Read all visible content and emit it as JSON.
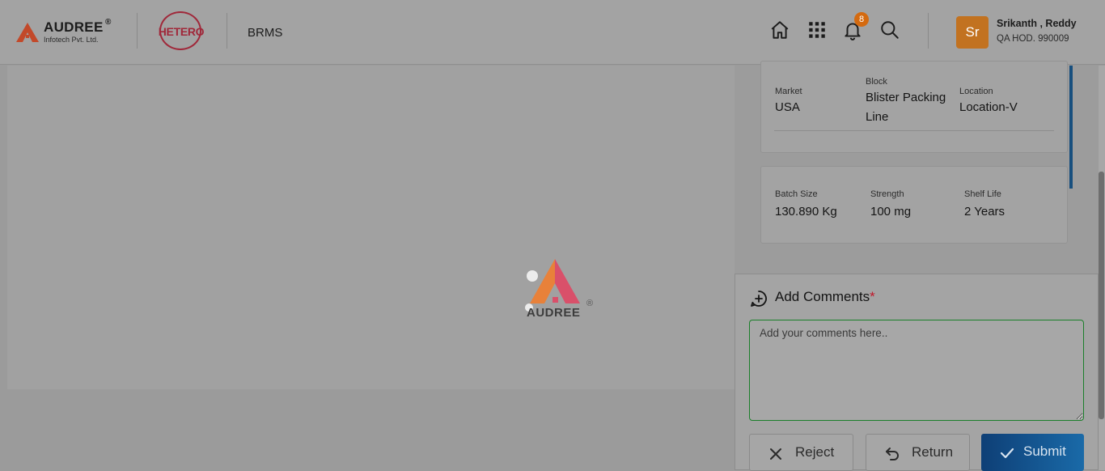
{
  "header": {
    "brand": {
      "name": "AUDREE",
      "registered": "®",
      "subtitle": "Infotech Pvt. Ltd."
    },
    "partner_logo": "HETERO",
    "app_name": "BRMS",
    "icons": [
      "home-icon",
      "apps-grid-icon",
      "bell-icon",
      "search-icon"
    ],
    "notification_count": "8",
    "user": {
      "initials": "Sr",
      "name": "Srikanth , Reddy",
      "role": "QA HOD. 990009"
    }
  },
  "loader": {
    "text": "AUDREE",
    "registered": "®"
  },
  "details": {
    "card1": {
      "market_label": "Market",
      "market_value": "USA",
      "block_label": "Block",
      "block_value": "Blister Packing Line",
      "location_label": "Location",
      "location_value": "Location-V"
    },
    "card2": {
      "batch_size_label": "Batch Size",
      "batch_size_value": "130.890 Kg",
      "strength_label": "Strength",
      "strength_value": "100 mg",
      "shelf_life_label": "Shelf Life",
      "shelf_life_value": "2 Years"
    }
  },
  "comments": {
    "title": "Add Comments",
    "required_mark": "*",
    "placeholder": "Add your comments here..",
    "value": ""
  },
  "actions": {
    "reject": "Reject",
    "return": "Return",
    "submit": "Submit"
  },
  "colors": {
    "accent_blue": "#174f7e",
    "submit_start": "#0e3f76",
    "submit_end": "#1a6aa8",
    "brand_orange": "#c27220",
    "badge_orange": "#d46a10",
    "hetero_red": "#a0283a",
    "required_red": "#c0182b",
    "textarea_border": "#1b7f2a"
  }
}
